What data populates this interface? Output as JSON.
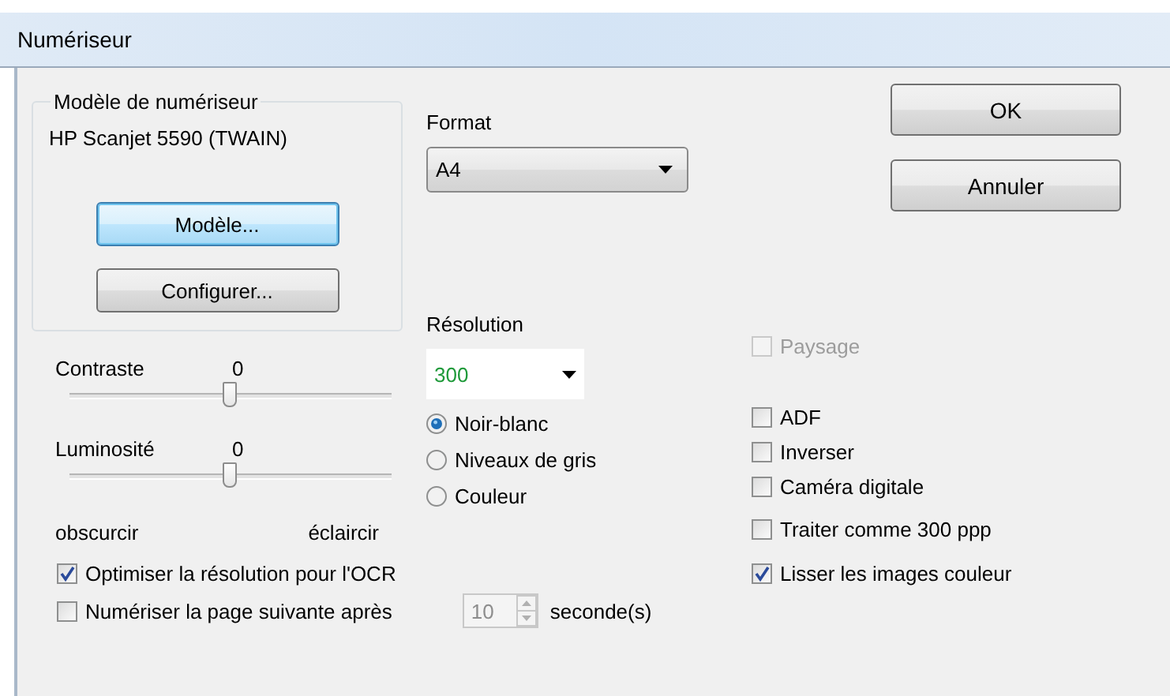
{
  "window": {
    "title": "Numériseur"
  },
  "scanner_group": {
    "title": "Modèle de numériseur",
    "model": "HP Scanjet 5590 (TWAIN)",
    "buttons": [
      {
        "label": "Modèle...",
        "focused": true
      },
      {
        "label": "Configurer...",
        "focused": false
      }
    ]
  },
  "format": {
    "label": "Format",
    "value": "A4"
  },
  "resolution": {
    "label": "Résolution",
    "value": "300"
  },
  "color_modes": [
    {
      "label": "Noir-blanc",
      "selected": true
    },
    {
      "label": "Niveaux de gris",
      "selected": false
    },
    {
      "label": "Couleur",
      "selected": false
    }
  ],
  "sliders": [
    {
      "label": "Contraste",
      "reading": "0",
      "level": 0.5
    },
    {
      "label": "Luminosité",
      "reading": "0",
      "level": 0.5
    }
  ],
  "slider_scale": {
    "min_label": "obscurcir",
    "max_label": "éclaircir"
  },
  "ocr_option": {
    "label": "Optimiser la résolution pour l'OCR",
    "checked": true
  },
  "next_page": {
    "label": "Numériser la page suivante après",
    "checked": false,
    "value": "10",
    "unit": "seconde(s)",
    "disabled": true
  },
  "landscape": {
    "label": "Paysage",
    "checked": false,
    "disabled": true
  },
  "options": [
    {
      "label": "ADF",
      "checked": false
    },
    {
      "label": "Inverser",
      "checked": false
    },
    {
      "label": "Caméra digitale",
      "checked": false
    },
    {
      "label": "Traiter comme 300 ppp",
      "checked": false
    },
    {
      "label": "Lisser les images couleur",
      "checked": true
    }
  ],
  "buttons": [
    {
      "label": "OK"
    },
    {
      "label": "Annuler"
    }
  ]
}
